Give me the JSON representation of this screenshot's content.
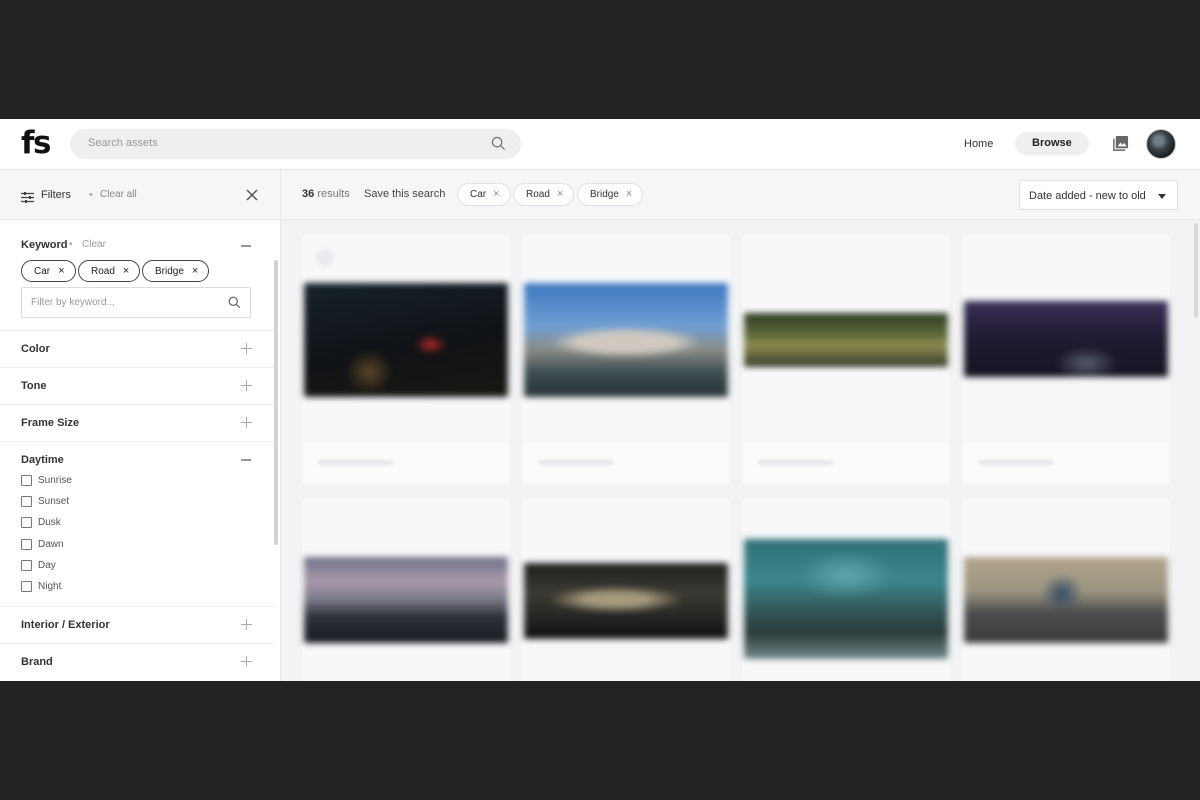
{
  "header": {
    "logo": "fs",
    "search_placeholder": "Search assets",
    "nav": {
      "home": "Home",
      "browse": "Browse"
    }
  },
  "sidebar": {
    "title": "Filters",
    "clear_all": "Clear all",
    "keyword": {
      "label": "Keyword",
      "clear": "Clear",
      "chips": [
        "Car",
        "Road",
        "Bridge"
      ],
      "filter_placeholder": "Filter by keyword..."
    },
    "sections": {
      "color": "Color",
      "tone": "Tone",
      "frame_size": "Frame Size",
      "daytime": "Daytime",
      "interior_exterior": "Interior / Exterior",
      "brand": "Brand"
    },
    "daytime_options": [
      "Sunrise",
      "Sunset",
      "Dusk",
      "Dawn",
      "Day",
      "Night"
    ]
  },
  "results": {
    "count": "36",
    "count_label": "results",
    "save_search": "Save this search",
    "active_chips": [
      "Car",
      "Road",
      "Bridge"
    ],
    "sort": "Date added - new to old"
  },
  "icons": {
    "search": "search-icon",
    "filters": "sliders-icon",
    "close": "close-icon",
    "library": "image-library-icon",
    "caret": "caret-down-icon"
  },
  "colors": {
    "page_bg": "#f3f3f5",
    "pill_bg": "#efeff1",
    "frame": "#232323"
  }
}
